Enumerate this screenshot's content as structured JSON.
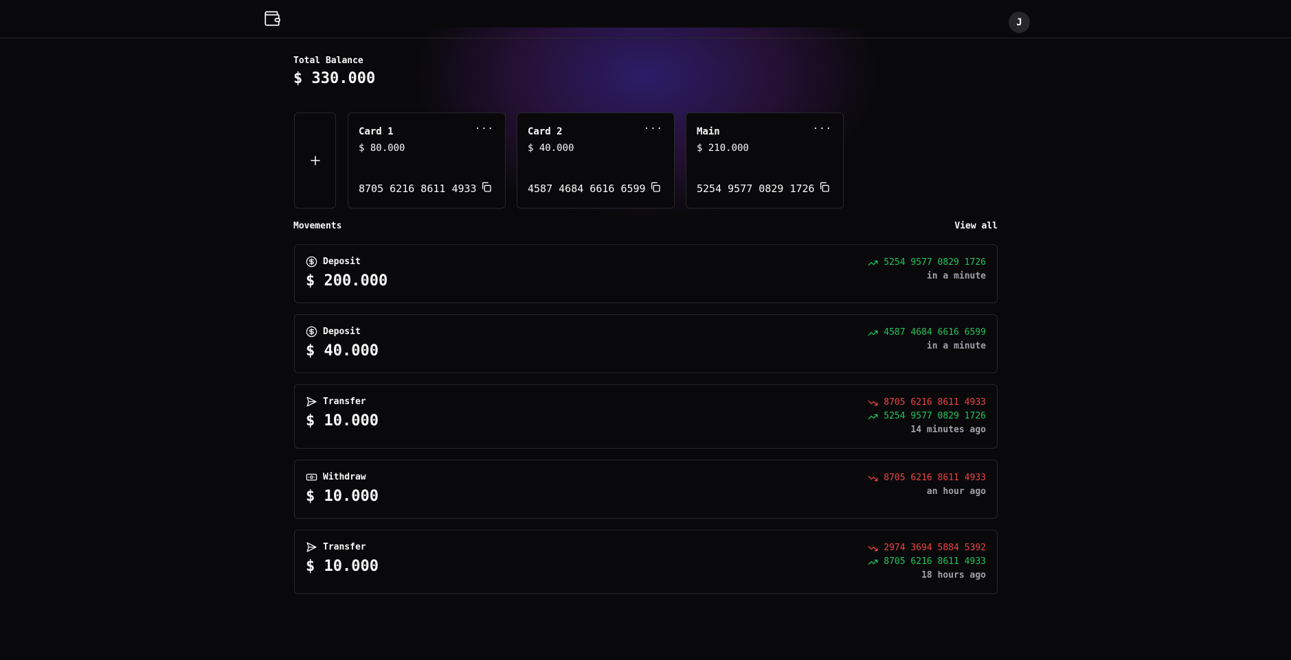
{
  "header": {
    "logo_icon": "wallet-icon",
    "avatar_initial": "J"
  },
  "balance": {
    "label": "Total Balance",
    "value": "$ 330.000"
  },
  "cards": [
    {
      "name": "Card 1",
      "amount": "$ 80.000",
      "number": "8705 6216 8611 4933",
      "menu": "···"
    },
    {
      "name": "Card 2",
      "amount": "$ 40.000",
      "number": "4587 4684 6616 6599",
      "menu": "···"
    },
    {
      "name": "Main",
      "amount": "$ 210.000",
      "number": "5254 9577 0829 1726",
      "menu": "···"
    }
  ],
  "movements": {
    "title": "Movements",
    "view_all": "View all",
    "items": [
      {
        "type": "Deposit",
        "icon": "dollar-circle-icon",
        "amount": "$ 200.000",
        "to": "5254 9577 0829 1726",
        "time": "in a minute"
      },
      {
        "type": "Deposit",
        "icon": "dollar-circle-icon",
        "amount": "$ 40.000",
        "to": "4587 4684 6616 6599",
        "time": "in a minute"
      },
      {
        "type": "Transfer",
        "icon": "send-icon",
        "amount": "$ 10.000",
        "from": "8705 6216 8611 4933",
        "to": "5254 9577 0829 1726",
        "time": "14 minutes ago"
      },
      {
        "type": "Withdraw",
        "icon": "banknote-icon",
        "amount": "$ 10.000",
        "from": "8705 6216 8611 4933",
        "time": "an hour ago"
      },
      {
        "type": "Transfer",
        "icon": "send-icon",
        "amount": "$ 10.000",
        "from": "2974 3694 5884 5392",
        "to": "8705 6216 8611 4933",
        "time": "18 hours ago"
      }
    ]
  },
  "colors": {
    "in": "#22c55e",
    "out": "#ef4444",
    "muted": "#a1a1aa",
    "border": "#27272a",
    "background": "#09090b"
  }
}
